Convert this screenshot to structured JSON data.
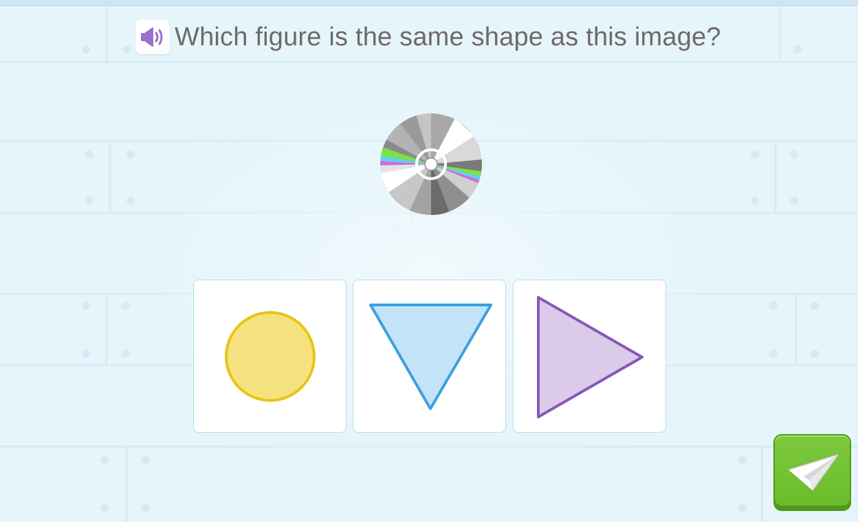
{
  "question": {
    "text": "Which figure is the same shape as this image?",
    "audio_icon": "speaker-icon"
  },
  "prompt_image": {
    "icon": "compact-disc-icon"
  },
  "choices": [
    {
      "shape": "circle",
      "fill": "#f5e27f",
      "stroke": "#e9c417"
    },
    {
      "shape": "triangle-down",
      "fill": "#c3e4f8",
      "stroke": "#3ba0e0"
    },
    {
      "shape": "triangle-right",
      "fill": "#dccbe8",
      "stroke": "#8658b9"
    }
  ],
  "submit": {
    "icon": "paper-plane-icon",
    "color": "#72c234"
  },
  "colors": {
    "background": "#e6f5fb",
    "question_text": "#6f6a68",
    "audio_icon": "#9b6fd0",
    "card_border": "#b7dced"
  }
}
